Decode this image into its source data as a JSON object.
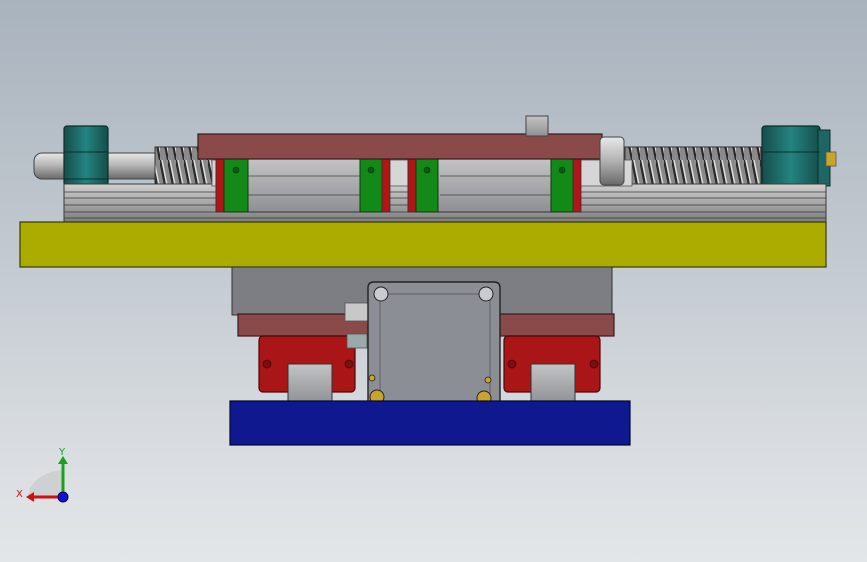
{
  "triad": {
    "y_label": "Y",
    "x_label": "X",
    "y_color": "#1aa11a",
    "x_color": "#d01010",
    "z_color": "#1010d0"
  },
  "colors": {
    "background_top": "#a9b3bd",
    "background_bottom": "#e3e6e9",
    "base_plate": "#acac00",
    "bottom_plate": "#101890",
    "carriage_plate": "#8a4a4a",
    "guide_block": "#aa1518",
    "cylinder": "#1f6f6a",
    "bearing_green": "#138a17",
    "motor_body": "#8b8e95"
  }
}
